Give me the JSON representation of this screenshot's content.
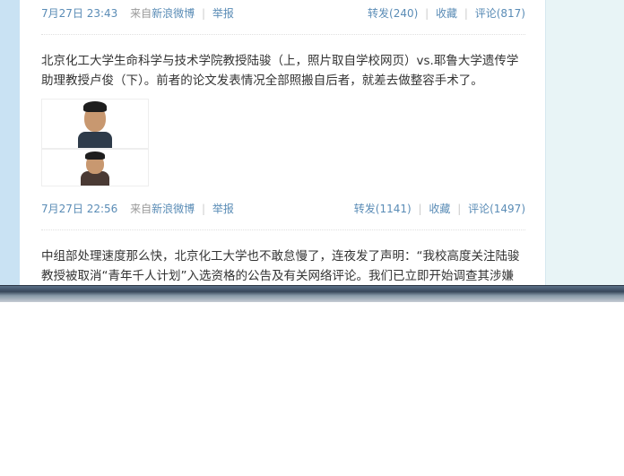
{
  "post1_meta": {
    "date": "7月27日 23:43",
    "source_prefix": "来自",
    "source_link": "新浪微博",
    "report": "举报",
    "repost": "转发(240)",
    "favorite": "收藏",
    "comment": "评论(817)"
  },
  "post2": {
    "text": "北京化工大学生命科学与技术学院教授陆骏（上，照片取自学校网页）vs.耶鲁大学遗传学助理教授卢俊（下）。前者的论文发表情况全部照搬自后者，就差去做整容手术了。",
    "images": [
      "photo-top-portrait",
      "photo-bottom-portrait"
    ],
    "meta": {
      "date": "7月27日 22:56",
      "source_prefix": "来自",
      "source_link": "新浪微博",
      "report": "举报",
      "repost": "转发(1141)",
      "favorite": "收藏",
      "comment": "评论(1497)"
    }
  },
  "post3": {
    "text": "中组部处理速度那么快，北京化工大学也不敢怠慢了，连夜发了声明：“我校高度关注陆骏教授被取消“青年千人计划”入选资格的公告及有关网络评论。我们已立即开始调查其涉嫌"
  },
  "colors": {
    "link": "#5a8cb6",
    "meta_gray": "#999999",
    "page_bg": "#cfe6f5",
    "right_panel": "#e8f4f6"
  }
}
